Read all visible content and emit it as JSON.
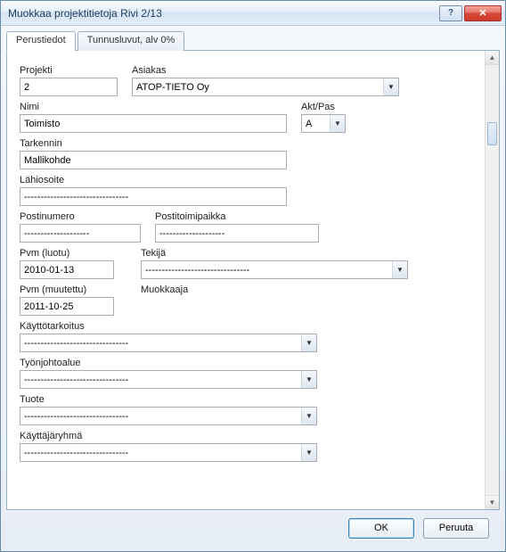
{
  "titlebar": {
    "title": "Muokkaa projektitietoja   Rivi 2/13"
  },
  "tabs": [
    {
      "label": "Perustiedot"
    },
    {
      "label": "Tunnusluvut, alv 0%"
    }
  ],
  "labels": {
    "projekti": "Projekti",
    "asiakas": "Asiakas",
    "nimi": "Nimi",
    "aktpas": "Akt/Pas",
    "tarkennin": "Tarkennin",
    "lahiosoite": "Lähiosoite",
    "postinumero": "Postinumero",
    "postitoimipaikka": "Postitoimipaikka",
    "pvm_luotu": "Pvm (luotu)",
    "tekija": "Tekijä",
    "pvm_muutettu": "Pvm (muutettu)",
    "muokkaaja": "Muokkaaja",
    "kayttotarkoitus": "Käyttötarkoitus",
    "tyonjohtoalue": "Työnjohtoalue",
    "tuote": "Tuote",
    "kayttajaryhma": "Käyttäjäryhmä"
  },
  "values": {
    "projekti": "2",
    "asiakas": "ATOP-TIETO Oy",
    "nimi": "Toimisto",
    "aktpas": "A",
    "tarkennin": "Mallikohde",
    "lahiosoite": "--------------------------------",
    "postinumero": "--------------------",
    "postitoimipaikka": "--------------------",
    "pvm_luotu": "2010-01-13",
    "tekija": "--------------------------------",
    "pvm_muutettu": "2011-10-25",
    "muokkaaja": "",
    "kayttotarkoitus": "--------------------------------",
    "tyonjohtoalue": "--------------------------------",
    "tuote": "--------------------------------",
    "kayttajaryhma": "--------------------------------"
  },
  "buttons": {
    "ok": "OK",
    "cancel": "Peruuta"
  }
}
